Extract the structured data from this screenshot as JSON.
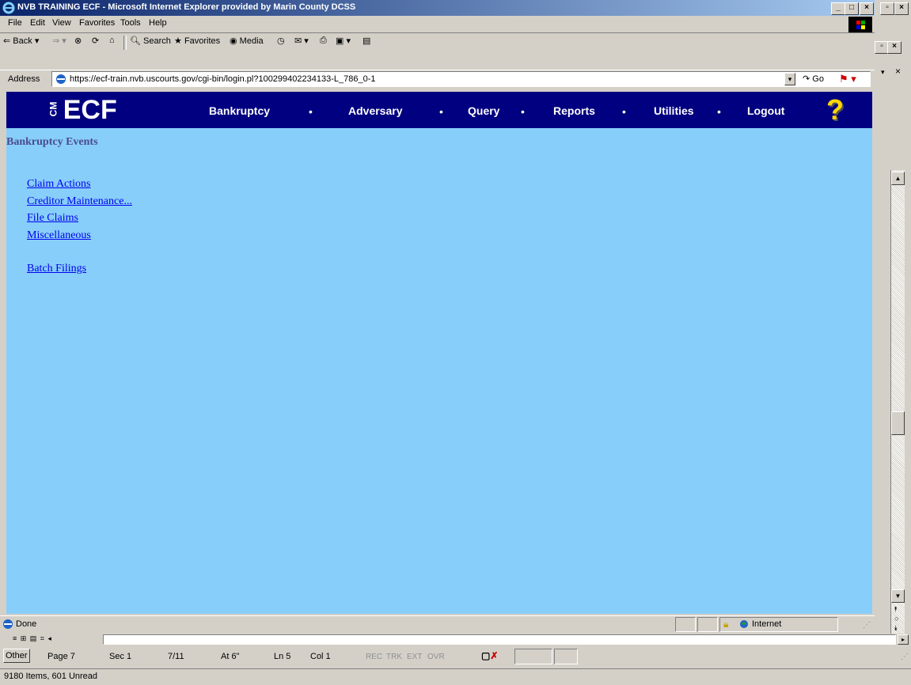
{
  "window": {
    "title": "NVB TRAINING ECF - Microsoft Internet Explorer provided by Marin County DCSS",
    "outer_controls": "_|5|x"
  },
  "menu": [
    "File",
    "Edit",
    "View",
    "Favorites",
    "Tools",
    "Help"
  ],
  "toolbar": {
    "back": "Back",
    "search": "Search",
    "favorites": "Favorites",
    "media": "Media"
  },
  "address": {
    "label": "Address",
    "url": "https://ecf-train.nvb.uscourts.gov/cgi-bin/login.pl?100299402234133-L_786_0-1",
    "go": "Go"
  },
  "ecf": {
    "logo": "ECF",
    "logo_prefix": "CM",
    "nav": [
      "Bankruptcy",
      "Adversary",
      "Query",
      "Reports",
      "Utilities",
      "Logout"
    ],
    "separator": "•",
    "help_icon": "?"
  },
  "page": {
    "heading": "Bankruptcy Events",
    "links": [
      "Claim Actions",
      "Creditor Maintenance...",
      "File Claims",
      "Miscellaneous"
    ],
    "batch_link": "Batch Filings"
  },
  "statusbar": {
    "text": "Done",
    "zone": "Internet"
  },
  "word_status": {
    "other": "Other",
    "page": "Page 7",
    "sec": "Sec 1",
    "pos": "7/11",
    "at": "At 6\"",
    "ln": "Ln 5",
    "col": "Col 1",
    "rec": "REC",
    "trk": "TRK",
    "ext": "EXT",
    "ovr": "OVR"
  },
  "outlook_status": "9180 Items, 601 Unread",
  "colors": {
    "content_bg": "#87cefa",
    "ecf_header": "#000080",
    "link": "#0000ee",
    "heading": "#4b4b8c"
  }
}
